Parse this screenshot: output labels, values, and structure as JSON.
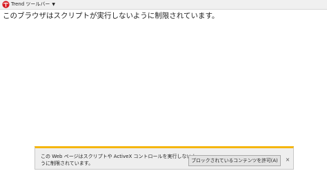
{
  "toolbar": {
    "brand_icon": "trend-micro-logo-icon",
    "label": "Trend ツールバー",
    "caret_icon": "caret-down-icon",
    "brand_color": "#d71920"
  },
  "main": {
    "message": "このブラウザはスクリプトが実行しないように制限されています。"
  },
  "infobar": {
    "accent_color": "#f5b60f",
    "message_line1": "この Web ページはスクリプトや ActiveX コントロールを実行しないよ",
    "message_line2": "うに制限されています。",
    "allow_button_label": "ブロックされているコンテンツを許可(A)",
    "close_icon": "close-icon",
    "close_glyph": "×"
  }
}
